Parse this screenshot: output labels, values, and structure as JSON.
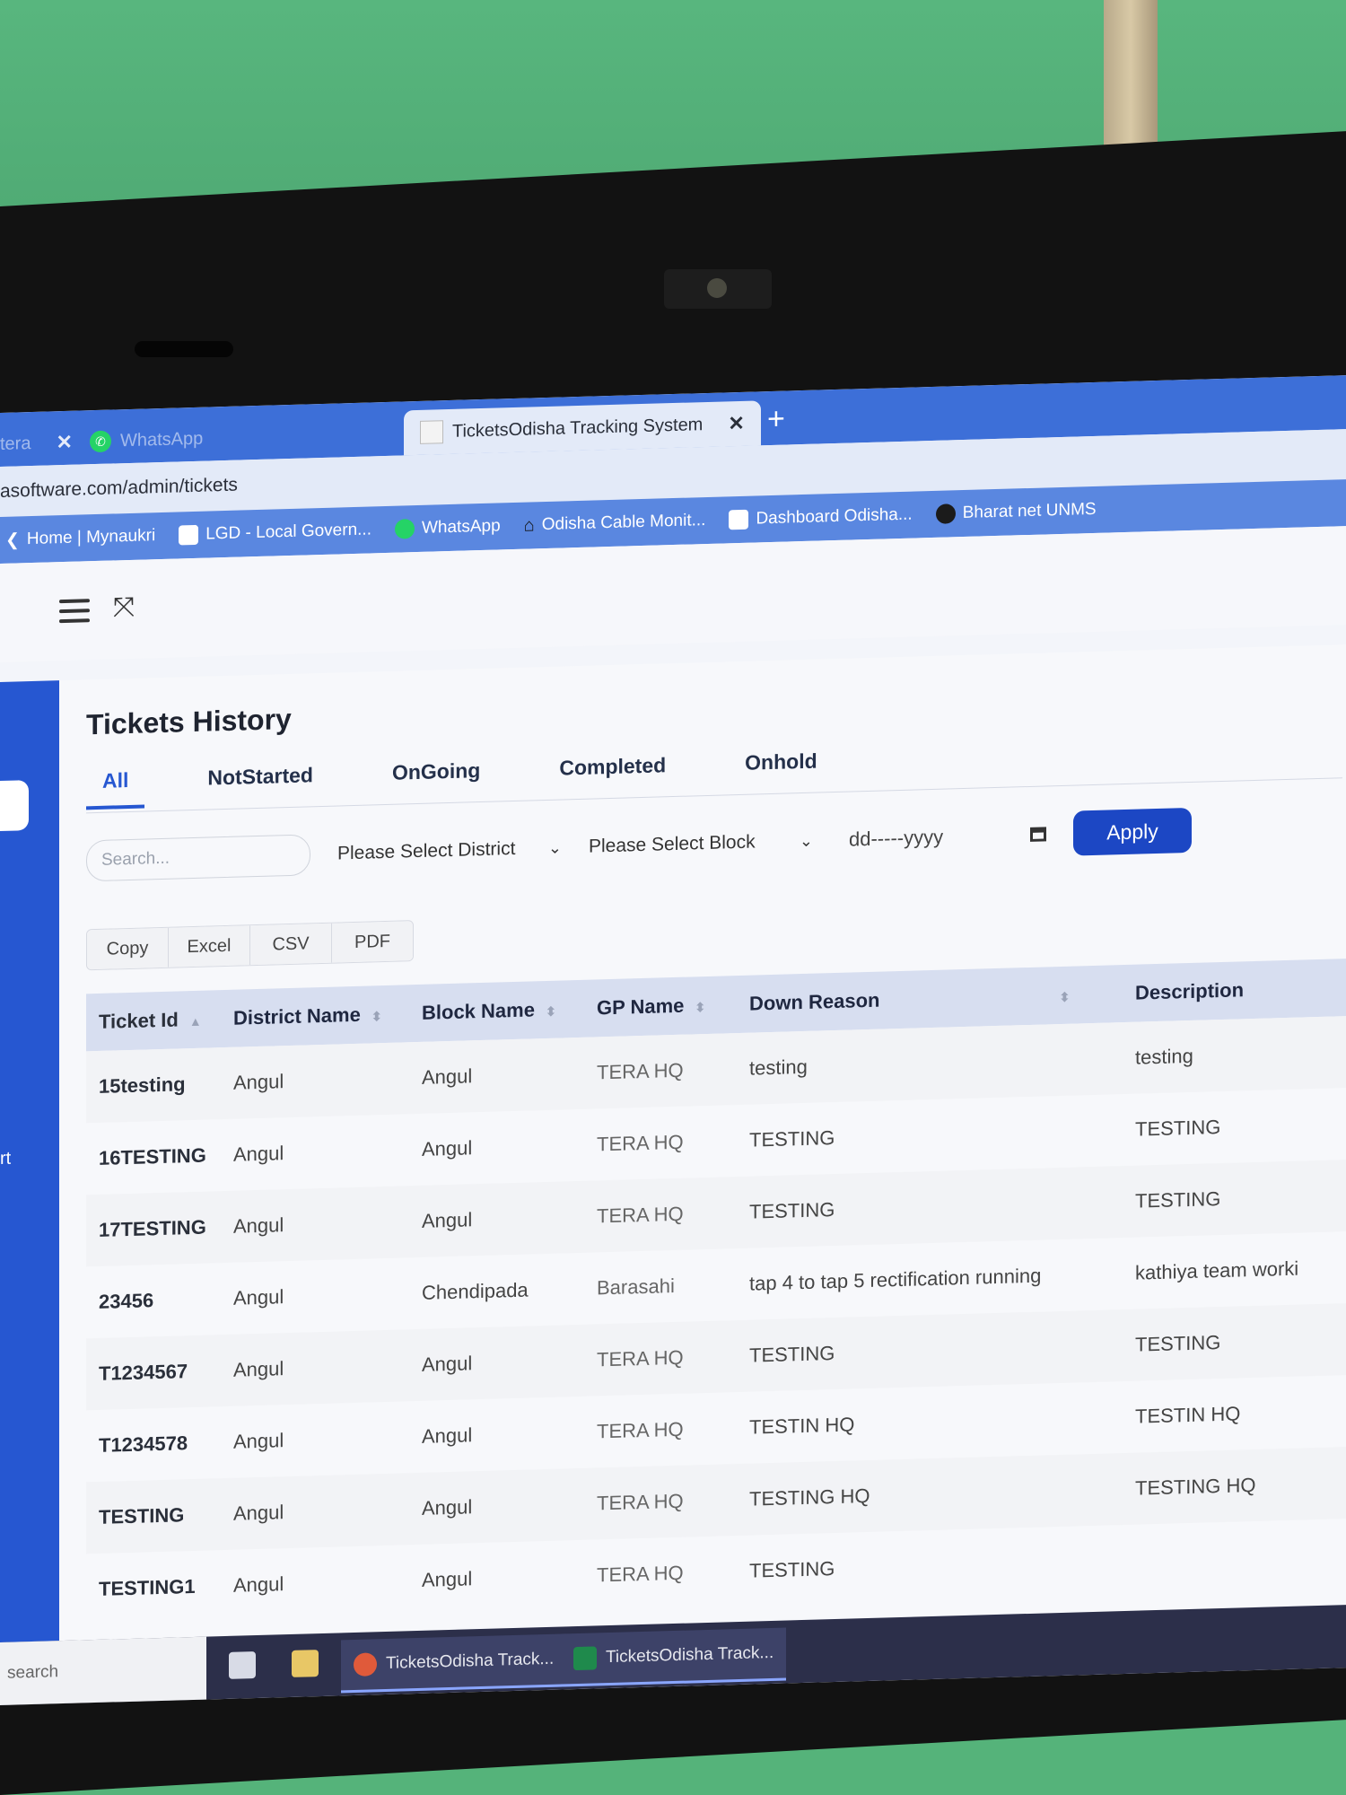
{
  "browser": {
    "tabs": [
      {
        "label": "tera",
        "close": "✕"
      },
      {
        "label": "WhatsApp"
      },
      {
        "label": "TicketsOdisha Tracking System",
        "close": "✕",
        "active": true
      }
    ],
    "new_tab": "+",
    "url": "asoftware.com/admin/tickets",
    "bookmarks": [
      {
        "label": "Home | Mynaukri",
        "icon": "back-chevron-icon"
      },
      {
        "label": "LGD - Local Govern...",
        "icon": "lgd-icon"
      },
      {
        "label": "WhatsApp",
        "icon": "whatsapp-icon"
      },
      {
        "label": "Odisha Cable Monit...",
        "icon": "house-icon"
      },
      {
        "label": "Dashboard Odisha...",
        "icon": "page-icon"
      },
      {
        "label": "Bharat net UNMS",
        "icon": "globe-icon"
      }
    ]
  },
  "page": {
    "title": "Tickets History",
    "tabs": [
      "All",
      "NotStarted",
      "OnGoing",
      "Completed",
      "Onhold"
    ],
    "active_tab": "All",
    "search_placeholder": "Search...",
    "district_select": "Please Select District",
    "block_select": "Please Select Block",
    "date_placeholder": "dd-----yyyy",
    "apply_label": "Apply",
    "export_buttons": [
      "Copy",
      "Excel",
      "CSV",
      "PDF"
    ],
    "sidebar_text": "rt"
  },
  "table": {
    "columns": [
      "Ticket Id",
      "District Name",
      "Block Name",
      "GP Name",
      "Down Reason",
      "Description"
    ],
    "rows": [
      [
        "15testing",
        "Angul",
        "Angul",
        "TERA HQ",
        "testing",
        "testing"
      ],
      [
        "16TESTING",
        "Angul",
        "Angul",
        "TERA HQ",
        "TESTING",
        "TESTING"
      ],
      [
        "17TESTING",
        "Angul",
        "Angul",
        "TERA HQ",
        "TESTING",
        "TESTING"
      ],
      [
        "23456",
        "Angul",
        "Chendipada",
        "Barasahi",
        "tap 4 to tap 5 rectification running",
        "kathiya team worki"
      ],
      [
        "T1234567",
        "Angul",
        "Angul",
        "TERA HQ",
        "TESTING",
        "TESTING"
      ],
      [
        "T1234578",
        "Angul",
        "Angul",
        "TERA HQ",
        "TESTIN HQ",
        "TESTIN HQ"
      ],
      [
        "TESTING",
        "Angul",
        "Angul",
        "TERA HQ",
        "TESTING HQ",
        "TESTING HQ"
      ],
      [
        "TESTING1",
        "Angul",
        "Angul",
        "TERA HQ",
        "TESTING",
        ""
      ]
    ]
  },
  "taskbar": {
    "search": "search",
    "apps": [
      "TicketsOdisha Track...",
      "TicketsOdisha Track..."
    ]
  },
  "colors": {
    "primary": "#2657d1",
    "apply_button": "#1c47c4",
    "browser_tabbar": "#3d6fd8",
    "wall": "#55b37a"
  }
}
